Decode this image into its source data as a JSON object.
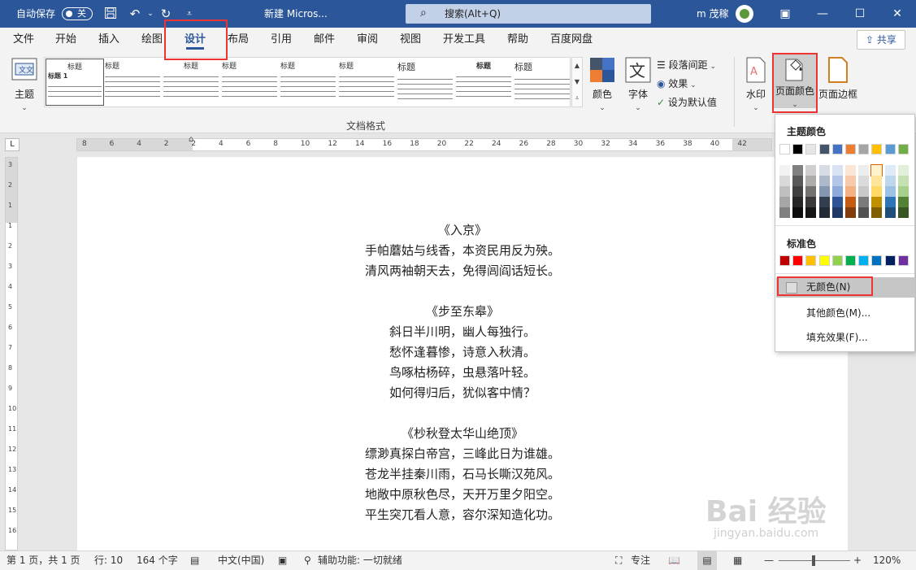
{
  "title_bar": {
    "autosave_label": "自动保存",
    "autosave_state": "关",
    "save_icon": "save-icon",
    "undo_icon": "undo-icon",
    "redo_icon": "redo-icon",
    "customize_icon": "qat-dropdown-icon",
    "doc_title": "新建 Micros...",
    "search_placeholder": "搜索(Alt+Q)",
    "user_name": "m 茂稼",
    "colors": {
      "bar": "#2b579a"
    }
  },
  "tabs": [
    "文件",
    "开始",
    "插入",
    "绘图",
    "设计",
    "布局",
    "引用",
    "邮件",
    "审阅",
    "视图",
    "开发工具",
    "帮助",
    "百度网盘"
  ],
  "active_tab": "设计",
  "share_label": "共享",
  "ribbon": {
    "theme_label": "主题",
    "style_headings": [
      "标题",
      "标题",
      "标题",
      "标题",
      "标题",
      "标题",
      "标题",
      "标题",
      "标题"
    ],
    "first_style_heading": "标题 1",
    "group_label": "文档格式",
    "colors_label": "颜色",
    "fonts_label": "字体",
    "paragraph_spacing_label": "段落间距",
    "effects_label": "效果",
    "set_default_label": "设为默认值",
    "watermark_label": "水印",
    "page_color_label": "页面颜色",
    "page_border_label": "页面边框"
  },
  "ruler": {
    "h_marks": [
      "8",
      "6",
      "4",
      "2",
      "2",
      "4",
      "6",
      "8",
      "10",
      "12",
      "14",
      "16",
      "18",
      "20",
      "22",
      "24",
      "26",
      "28",
      "30",
      "32",
      "34",
      "36",
      "38",
      "40",
      "42"
    ],
    "v_marks": [
      "3",
      "2",
      "1",
      "1",
      "2",
      "3",
      "4",
      "5",
      "6",
      "7",
      "8",
      "9",
      "10",
      "11",
      "12",
      "13",
      "14",
      "15",
      "16"
    ]
  },
  "document": {
    "poems": [
      {
        "title": "《入京》",
        "lines": [
          "手帕蘑姑与线香，本资民用反为殃。",
          "清风两袖朝天去，免得闾阎话短长。"
        ]
      },
      {
        "title": "《步至东皋》",
        "lines": [
          "斜日半川明，幽人每独行。",
          "愁怀逢暮惨，诗意入秋清。",
          "鸟啄枯杨碎，虫悬落叶轻。",
          "如何得归后，犹似客中情？"
        ]
      },
      {
        "title": "《杪秋登太华山绝顶》",
        "lines": [
          "缥渺真探白帝宫，三峰此日为谁雄。",
          "苍龙半挂秦川雨，石马长嘶汉苑风。",
          "地敞中原秋色尽，天开万里夕阳空。",
          "平生突兀看人意，容尔深知造化功。"
        ]
      }
    ]
  },
  "page_color_menu": {
    "theme_colors_label": "主题颜色",
    "theme_top_row": [
      "#ffffff",
      "#000000",
      "#e7e6e6",
      "#44546a",
      "#4472c4",
      "#ed7d31",
      "#a5a5a5",
      "#ffc000",
      "#5b9bd5",
      "#70ad47"
    ],
    "theme_columns": [
      [
        "#f2f2f2",
        "#d9d9d9",
        "#bfbfbf",
        "#a6a6a6",
        "#808080"
      ],
      [
        "#808080",
        "#595959",
        "#404040",
        "#262626",
        "#0d0d0d"
      ],
      [
        "#d0cece",
        "#aeabab",
        "#757171",
        "#3a3838",
        "#171616"
      ],
      [
        "#d6dce4",
        "#adb9ca",
        "#8497b0",
        "#333f4f",
        "#222a35"
      ],
      [
        "#d9e2f3",
        "#b4c6e7",
        "#8eaadb",
        "#2f5496",
        "#1f3864"
      ],
      [
        "#fbe5d5",
        "#f7caac",
        "#f4b183",
        "#c55a11",
        "#833c0b"
      ],
      [
        "#ededed",
        "#dbdbdb",
        "#c9c9c9",
        "#7b7b7b",
        "#525252"
      ],
      [
        "#fff2cc",
        "#ffe599",
        "#ffd966",
        "#bf9000",
        "#7f6000"
      ],
      [
        "#deebf6",
        "#bdd7ee",
        "#9cc3e5",
        "#2e75b5",
        "#1f4e79"
      ],
      [
        "#e2efd9",
        "#c5e0b3",
        "#a8d08d",
        "#538135",
        "#375623"
      ]
    ],
    "standard_colors_label": "标准色",
    "standard_colors": [
      "#c00000",
      "#ff0000",
      "#ffc000",
      "#ffff00",
      "#92d050",
      "#00b050",
      "#00b0f0",
      "#0070c0",
      "#002060",
      "#7030a0"
    ],
    "no_color_label": "无颜色(N)",
    "more_colors_label": "其他颜色(M)...",
    "fill_effects_label": "填充效果(F)..."
  },
  "status_bar": {
    "page_info": "第 1 页，共 1 页",
    "line_info": "行: 10",
    "word_count": "164 个字",
    "language": "中文(中国)",
    "accessibility": "辅助功能: 一切就绪",
    "focus_label": "专注",
    "zoom": "120%"
  },
  "watermark": {
    "text": "Bai 经验",
    "sub": "jingyan.baidu.com"
  }
}
